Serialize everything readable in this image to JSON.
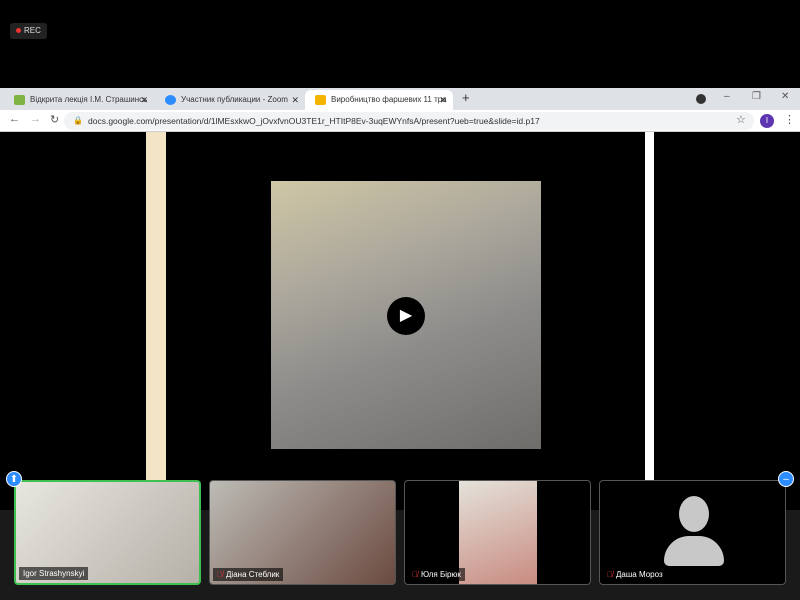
{
  "recording": {
    "label": "REC"
  },
  "browser": {
    "tabs": [
      {
        "title": "Відкрита лекція І.М. Страшинсь",
        "icon_color": "#7cb342"
      },
      {
        "title": "Участник публикации - Zoom",
        "icon_color": "#2d8cff"
      },
      {
        "title": "Виробництво фаршевих 11 тра",
        "icon_color": "#f4b400",
        "active": true
      }
    ],
    "new_tab": "+",
    "url": "docs.google.com/presentation/d/1lMEsxkwO_jOvxfvnOU3TE1r_HTItP8Ev-3uqEWYnfsA/present?ueb=true&slide=id.p17",
    "profile_initial": "I"
  },
  "participants": [
    {
      "name": "Igor Strashynskyi",
      "muted": false,
      "active_speaker": true
    },
    {
      "name": "Діана Стеблик",
      "muted": true
    },
    {
      "name": "Юля Бірюк",
      "muted": true
    },
    {
      "name": "Даша Мороз",
      "muted": true
    }
  ]
}
